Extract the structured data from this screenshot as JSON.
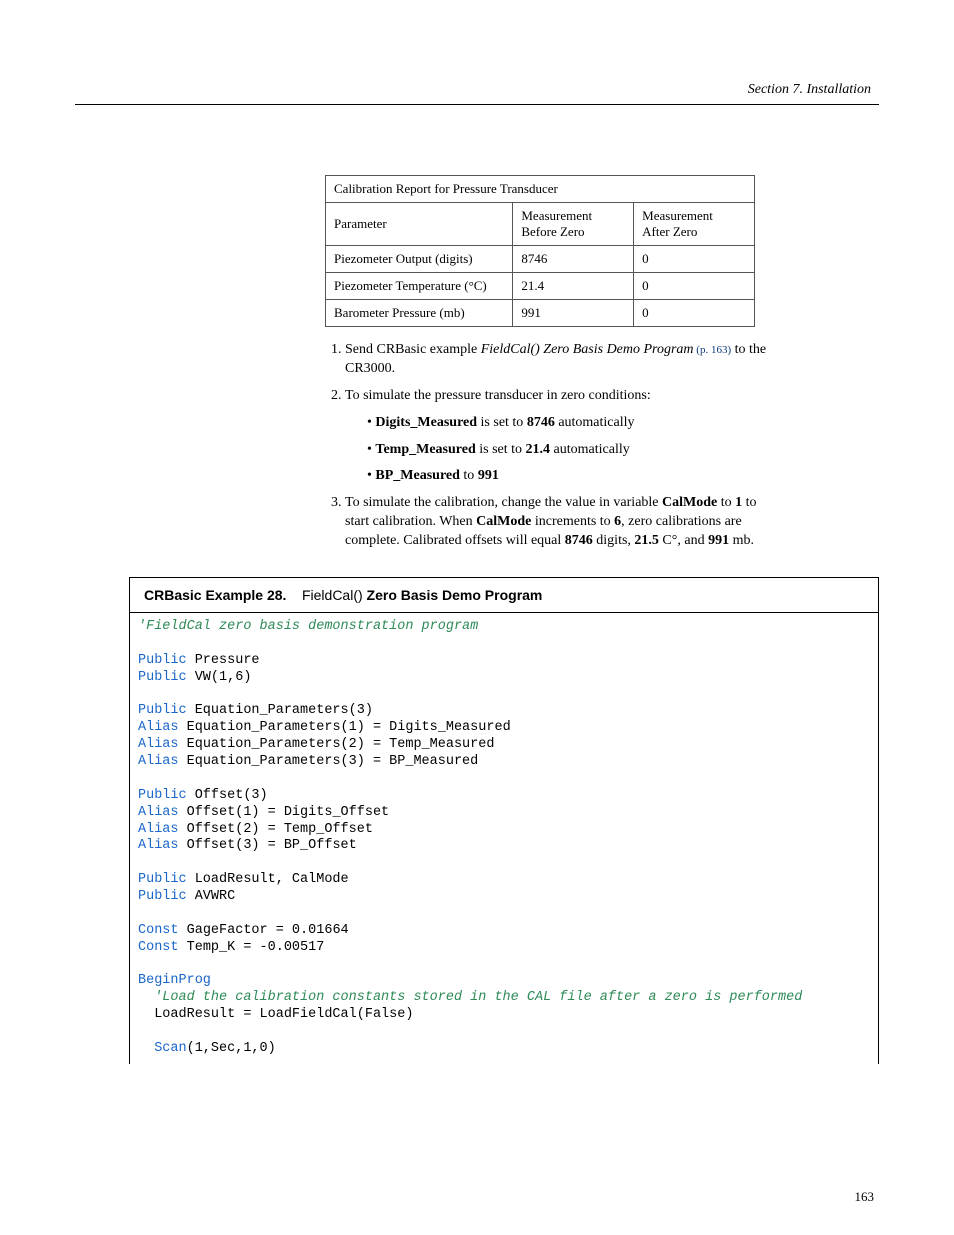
{
  "header": {
    "section": "Section 7.  Installation"
  },
  "table": {
    "caption": "Calibration Report for Pressure Transducer",
    "h1": "Parameter",
    "h2_l1": "Measurement",
    "h2_l2": "Before Zero",
    "h3_l1": "Measurement",
    "h3_l2": "After Zero",
    "rows": [
      {
        "p": "Piezometer Output (digits)",
        "b": "8746",
        "a": "0"
      },
      {
        "p": "Piezometer Temperature (°C)",
        "b": "21.4",
        "a": "0"
      },
      {
        "p": "Barometer Pressure (mb)",
        "b": "991",
        "a": "0"
      }
    ]
  },
  "steps": {
    "s1_a": "Send CRBasic example ",
    "s1_i": "FieldCal() Zero Basis Demo Program",
    "s1_link": " (p. 163)",
    "s1_b": " to the CR3000.",
    "s2": "To simulate the pressure transducer in zero conditions:",
    "b1_a": "Digits_Measured",
    "b1_b": " is set to ",
    "b1_c": "8746",
    "b1_d": " automatically",
    "b2_a": "Temp_Measured",
    "b2_b": " is set to ",
    "b2_c": "21.4",
    "b2_d": " automatically",
    "b3_a": "BP_Measured",
    "b3_b": " to ",
    "b3_c": "991",
    "s3_a": "To simulate the calibration, change the value in variable ",
    "s3_b": "CalMode",
    "s3_c": " to ",
    "s3_d": "1",
    "s3_e": " to start calibration. When ",
    "s3_f": "CalMode",
    "s3_g": " increments to ",
    "s3_h": "6",
    "s3_i": ", zero calibrations are complete. Calibrated offsets will equal ",
    "s3_j": "8746",
    "s3_k": " digits, ",
    "s3_l": "21.5",
    "s3_m": " C°, and ",
    "s3_n": "991",
    "s3_o": " mb."
  },
  "codebox": {
    "label": "CRBasic Example 28.",
    "fn": "FieldCal()",
    "title_rest": " Zero Basis Demo Program",
    "c_comment1": "'FieldCal zero basis demonstration program",
    "c_pub": "Public",
    "c_alias": "Alias",
    "c_const": "Const",
    "c_begin": "BeginProg",
    "c_scan": "Scan",
    "c_l_pressure": " Pressure",
    "c_l_vw": " VW(1,6)",
    "c_l_eqparams": " Equation_Parameters(3)",
    "c_l_ep1": " Equation_Parameters(1) = Digits_Measured",
    "c_l_ep2": " Equation_Parameters(2) = Temp_Measured",
    "c_l_ep3": " Equation_Parameters(3) = BP_Measured",
    "c_l_offset": " Offset(3)",
    "c_l_off1": " Offset(1) = Digits_Offset",
    "c_l_off2": " Offset(2) = Temp_Offset",
    "c_l_off3": " Offset(3) = BP_Offset",
    "c_l_load": " LoadResult, CalMode",
    "c_l_avwrc": " AVWRC",
    "c_l_gage": " GageFactor = 0.01664",
    "c_l_tempk": " Temp_K = -0.00517",
    "c_comment2": "  'Load the calibration constants stored in the CAL file after a zero is performed",
    "c_l_loadres": "  LoadResult = LoadFieldCal(False)",
    "c_l_scanargs": "(1,Sec,1,0)"
  },
  "pagenum": "163"
}
